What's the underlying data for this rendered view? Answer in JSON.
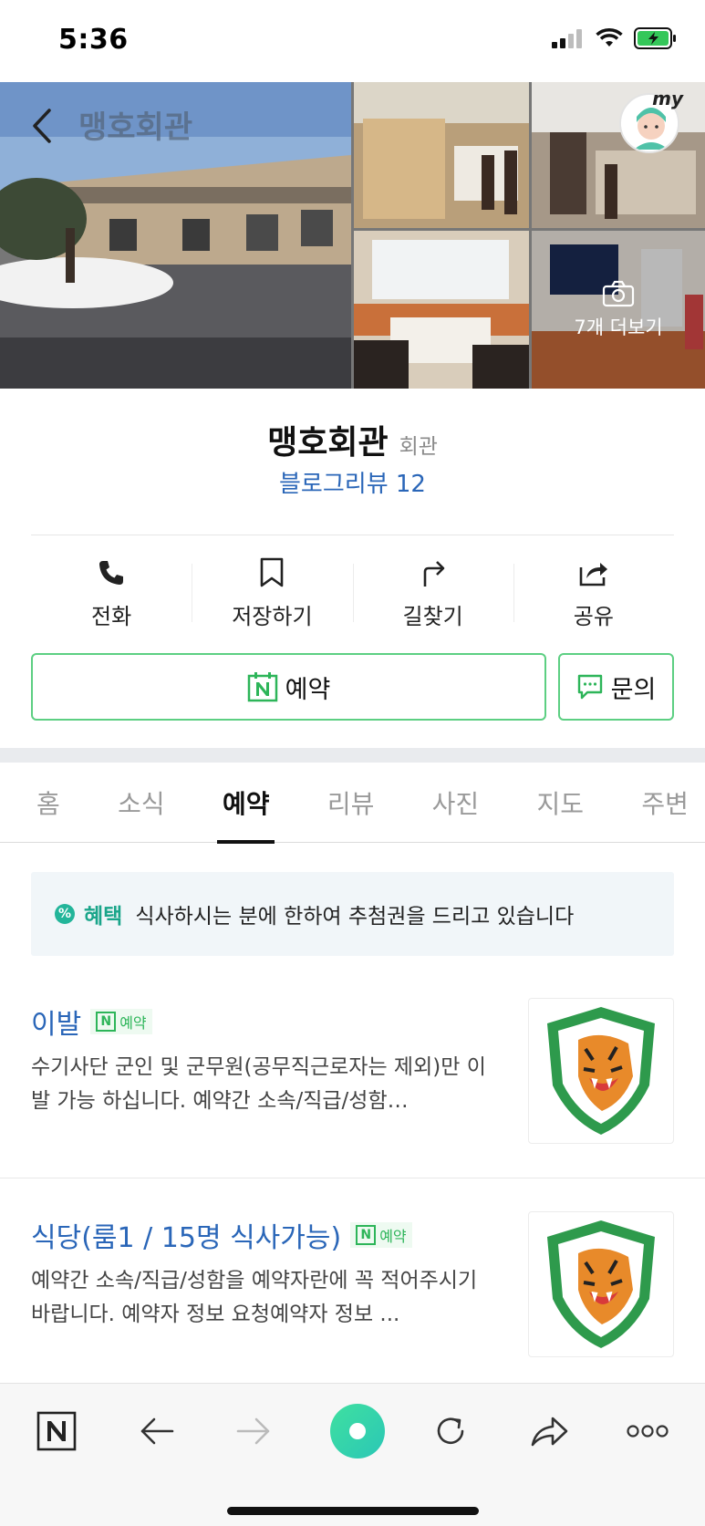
{
  "status_bar": {
    "time": "5:36"
  },
  "header": {
    "title": "맹호회관",
    "my_label": "my"
  },
  "photos": {
    "more_label": "7개 더보기"
  },
  "place": {
    "name": "맹호회관",
    "category": "회관",
    "blog_review": "블로그리뷰 12"
  },
  "actions": [
    {
      "label": "전화",
      "icon": "phone-icon"
    },
    {
      "label": "저장하기",
      "icon": "bookmark-icon"
    },
    {
      "label": "길찾기",
      "icon": "directions-icon"
    },
    {
      "label": "공유",
      "icon": "share-icon"
    }
  ],
  "reserve_button": {
    "label": "예약"
  },
  "inquiry_button": {
    "label": "문의"
  },
  "tabs": [
    {
      "label": "홈",
      "active": false
    },
    {
      "label": "소식",
      "active": false
    },
    {
      "label": "예약",
      "active": true
    },
    {
      "label": "리뷰",
      "active": false
    },
    {
      "label": "사진",
      "active": false
    },
    {
      "label": "지도",
      "active": false
    },
    {
      "label": "주변",
      "active": false
    }
  ],
  "benefit": {
    "title": "혜택",
    "text": "식사하시는 분에 한하여 추첨권을 드리고 있습니다"
  },
  "items": [
    {
      "title": "이발",
      "badge": "예약",
      "desc": "수기사단 군인 및 군무원(공무직근로자는 제외)만 이발 가능 하십니다. 예약간 소속/직급/성함…"
    },
    {
      "title": "식당(룸1 / 15명 식사가능)",
      "badge": "예약",
      "desc": "예약간 소속/직급/성함을 예약자란에 꼭 적어주시기 바랍니다. 예약자 정보 요청예약자 정보 ..."
    }
  ],
  "colors": {
    "accent_green": "#2db559",
    "link_blue": "#2a66b8",
    "benefit_teal": "#1aa58a"
  }
}
